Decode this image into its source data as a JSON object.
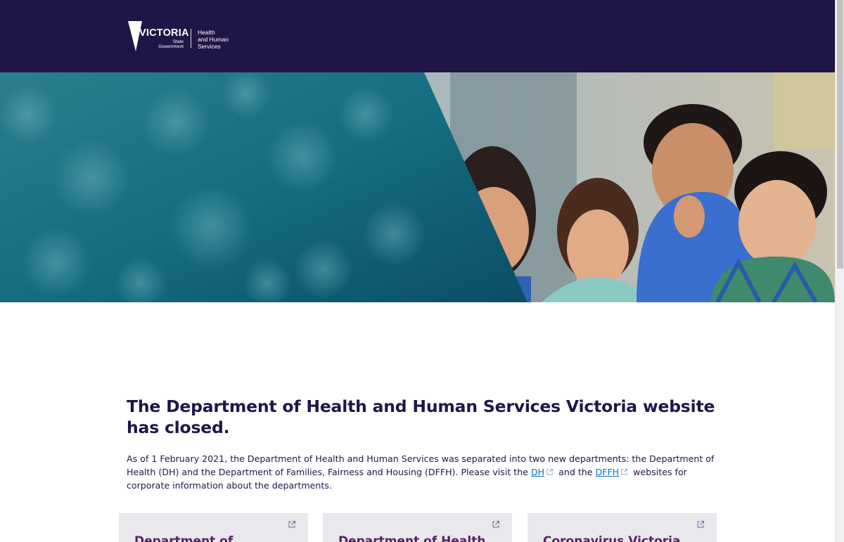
{
  "header": {
    "logo_wordmark": "VICTORIA",
    "logo_sub_line1": "State",
    "logo_sub_line2": "Government",
    "dept_line1": "Health",
    "dept_line2": "and Human",
    "dept_line3": "Services"
  },
  "main": {
    "title": "The Department of Health and Human Services Victoria website has closed.",
    "intro_part1": "As of 1 February 2021, the Department of Health and Human Services was separated into two new departments: the Department of Health (DH) and the Department of Families, Fairness and Housing (DFFH). Please visit the ",
    "link_dh": "DH",
    "intro_part2": " and the ",
    "link_dffh": "DFFH",
    "intro_part3": " websites for corporate information about the departments."
  },
  "cards": [
    {
      "title": "Department of"
    },
    {
      "title": "Department of Health"
    },
    {
      "title": "Coronavirus Victoria"
    }
  ],
  "icons": {
    "external": "external-link-icon",
    "logo_triangle": "victoria-logo-triangle"
  },
  "colors": {
    "header_bg": "#201547",
    "text": "#201547",
    "link": "#0072ce",
    "card_bg": "#e8e8ed",
    "card_title": "#5b1f69",
    "hero_teal": "#0e6f84"
  }
}
